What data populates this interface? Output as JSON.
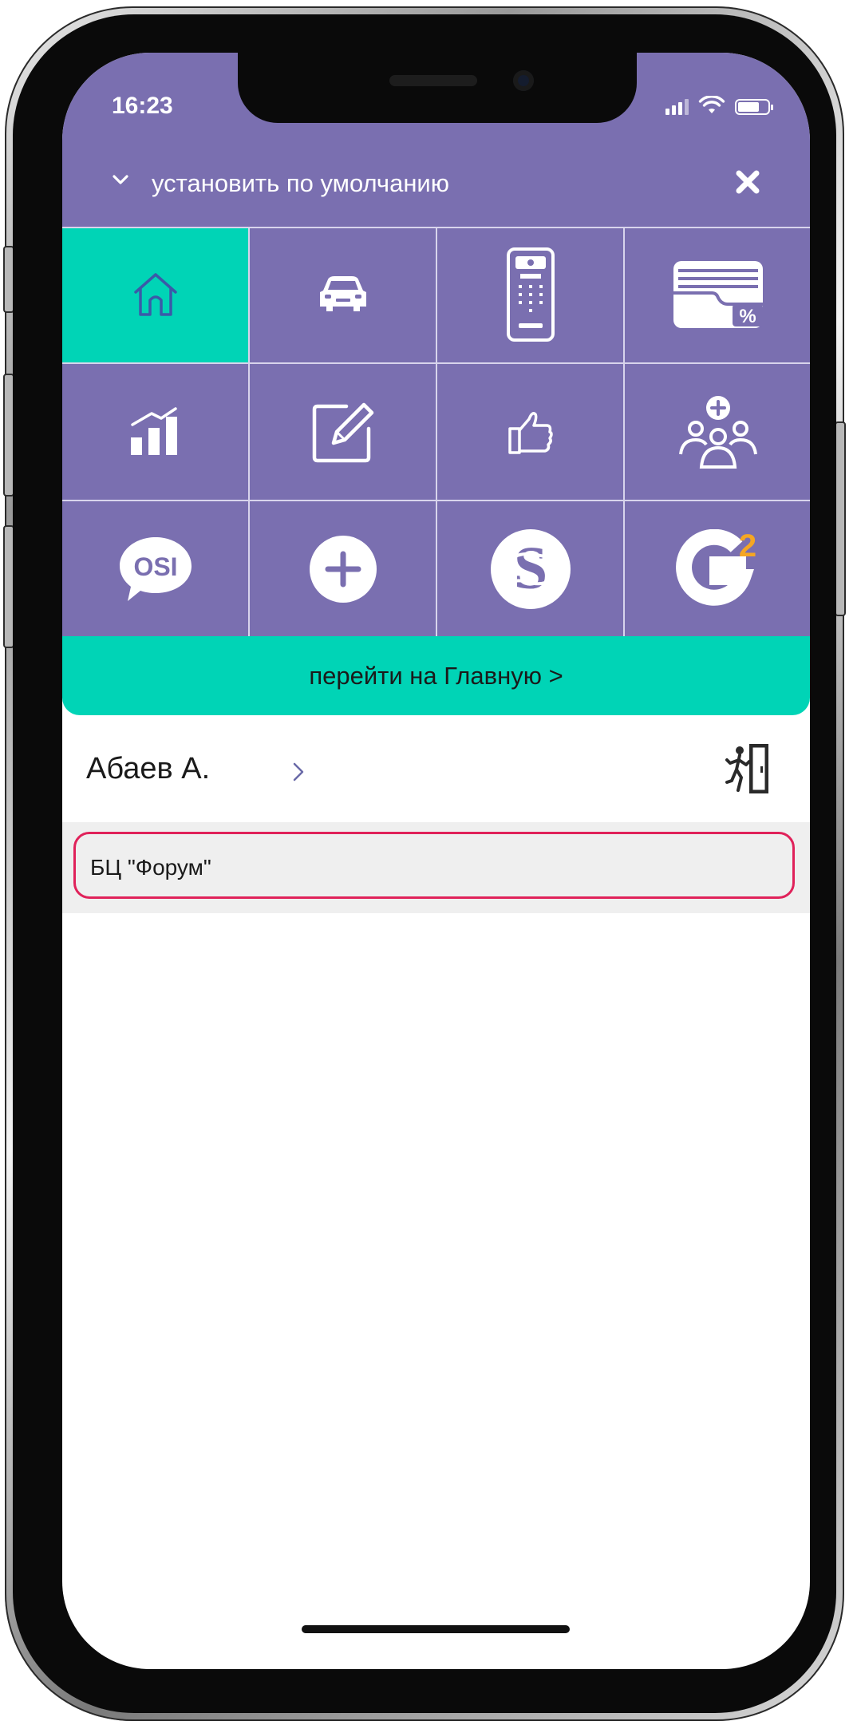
{
  "status_bar": {
    "time": "16:23",
    "icons": [
      "signal-icon",
      "wifi-icon",
      "battery-icon"
    ]
  },
  "header": {
    "title": "установить по умолчанию",
    "chevron_icon": "chevron-down-icon",
    "close_icon": "close-icon"
  },
  "grid": {
    "tiles": [
      {
        "icon": "home-icon",
        "active": true
      },
      {
        "icon": "car-icon",
        "active": false
      },
      {
        "icon": "intercom-icon",
        "active": false
      },
      {
        "icon": "wallet-discount-icon",
        "active": false
      },
      {
        "icon": "chart-icon",
        "active": false
      },
      {
        "icon": "edit-icon",
        "active": false
      },
      {
        "icon": "thumbs-up-icon",
        "active": false
      },
      {
        "icon": "group-add-icon",
        "active": false
      },
      {
        "icon": "osi-logo-icon",
        "active": false
      },
      {
        "icon": "plus-icon",
        "active": false
      },
      {
        "icon": "s-logo-icon",
        "active": false
      },
      {
        "icon": "g2-logo-icon",
        "active": false
      }
    ],
    "osi_logo_text": "OSI",
    "g2_superscript": "2"
  },
  "main_link": {
    "label": "перейти на Главную >"
  },
  "user": {
    "name": "Абаев А.",
    "chevron_icon": "chevron-right-icon",
    "logout_icon": "logout-door-icon"
  },
  "addresses": [
    {
      "label": "БЦ \"Форум\"",
      "selected": true
    }
  ],
  "colors": {
    "primary": "#7a6fb0",
    "accent": "#00d4b6",
    "selected_border": "#e0225a",
    "g2_accent": "#f5a623"
  }
}
